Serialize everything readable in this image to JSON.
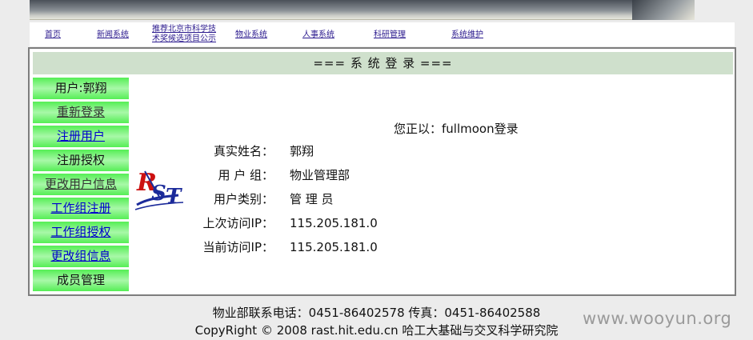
{
  "nav": {
    "items": [
      {
        "label": "首页"
      },
      {
        "label": "新闻系统"
      },
      {
        "label": "推荐北京市科学技术奖候选项目公示"
      },
      {
        "label": "物业系统"
      },
      {
        "label": "人事系统"
      },
      {
        "label": "科研管理"
      },
      {
        "label": "系统维护"
      }
    ]
  },
  "panel": {
    "title": "=== 系 统 登 录 ==="
  },
  "menu": {
    "items": [
      {
        "label": "用户:郭翔"
      },
      {
        "label": "重新登录"
      },
      {
        "label": "注册用户"
      },
      {
        "label": "注册授权"
      },
      {
        "label": "更改用户信息"
      },
      {
        "label": "工作组注册"
      },
      {
        "label": "工作组授权"
      },
      {
        "label": "更改组信息"
      },
      {
        "label": "成员管理"
      }
    ]
  },
  "logo": {
    "icon": "rst-logo",
    "text": "RST"
  },
  "welcome": "您正以：fullmoon登录",
  "info": [
    {
      "label": "真实姓名：",
      "value": "郭翔"
    },
    {
      "label": "用 户 组：",
      "value": "物业管理部"
    },
    {
      "label": "用户类别：",
      "value": "管 理 员"
    },
    {
      "label": "上次访问IP：",
      "value": "115.205.181.0"
    },
    {
      "label": "当前访问IP：",
      "value": "115.205.181.0"
    }
  ],
  "footer": {
    "contact": "物业部联系电话：0451-86402578 传真：0451-86402588",
    "copyright": "CopyRight © 2008 rast.hit.edu.cn 哈工大基础与交叉科学研究院"
  },
  "watermark": "www.wooyun.org"
}
